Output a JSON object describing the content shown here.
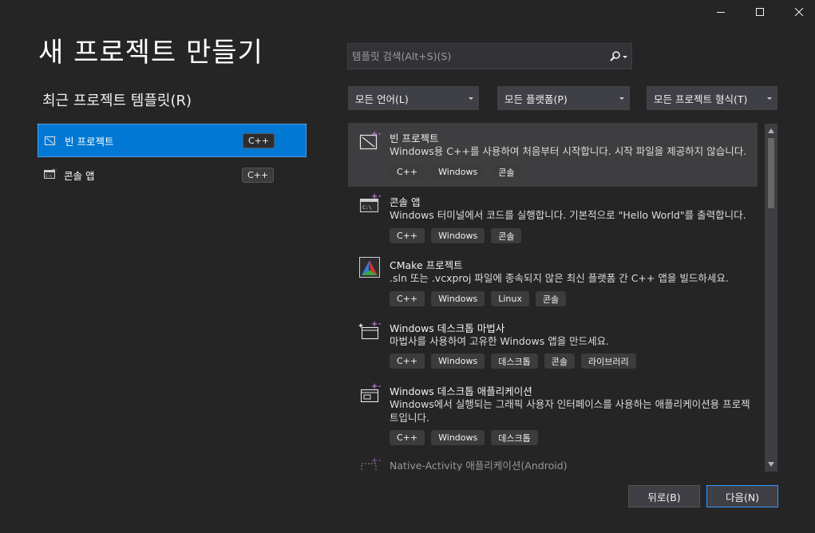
{
  "window": {
    "minimize_glyph": "—",
    "maximize_glyph": "☐",
    "close_glyph": "✕"
  },
  "page_title": "새 프로젝트 만들기",
  "recent": {
    "title": "최근 프로젝트 템플릿(R)",
    "items": [
      {
        "label": "빈 프로젝트",
        "tag": "C++",
        "icon": "empty-project-icon",
        "selected": true
      },
      {
        "label": "콘솔 앱",
        "tag": "C++",
        "icon": "console-app-icon",
        "selected": false
      }
    ]
  },
  "search": {
    "placeholder": "템플릿 검색(Alt+S)(S)",
    "value": ""
  },
  "filters": {
    "language": "모든 언어(L)",
    "platform": "모든 플랫폼(P)",
    "project_type": "모든 프로젝트 형식(T)"
  },
  "templates": [
    {
      "name": "빈 프로젝트",
      "description": "Windows용 C++를 사용하여 처음부터 시작합니다. 시작 파일을 제공하지 않습니다.",
      "tags": [
        "C++",
        "Windows",
        "콘솔"
      ],
      "icon": "empty-project-icon"
    },
    {
      "name": "콘솔 앱",
      "description": "Windows 터미널에서 코드를 실행합니다. 기본적으로 \"Hello World\"를 출력합니다.",
      "tags": [
        "C++",
        "Windows",
        "콘솔"
      ],
      "icon": "console-app-icon"
    },
    {
      "name": "CMake 프로젝트",
      "description": ".sln 또는 .vcxproj 파일에 종속되지 않은 최신 플랫폼 간 C++ 앱을 빌드하세요.",
      "tags": [
        "C++",
        "Windows",
        "Linux",
        "콘솔"
      ],
      "icon": "cmake-icon"
    },
    {
      "name": "Windows 데스크톱 마법사",
      "description": "마법사를 사용하여 고유한 Windows 앱을 만드세요.",
      "tags": [
        "C++",
        "Windows",
        "데스크톱",
        "콘솔",
        "라이브러리"
      ],
      "icon": "desktop-wizard-icon"
    },
    {
      "name": "Windows 데스크톱 애플리케이션",
      "description": "Windows에서 실행되는 그래픽 사용자 인터페이스를 사용하는 애플리케이션용 프로젝트입니다.",
      "tags": [
        "C++",
        "Windows",
        "데스크톱"
      ],
      "icon": "desktop-app-icon"
    },
    {
      "name": "Native-Activity 애플리케이션(Android)",
      "description": "",
      "tags": [],
      "icon": "android-native-icon"
    }
  ],
  "buttons": {
    "back": "뒤로(B)",
    "next": "다음(N)"
  },
  "colors": {
    "background": "#252526",
    "accent": "#0078d4",
    "cpp_purple": "#b180d7"
  }
}
